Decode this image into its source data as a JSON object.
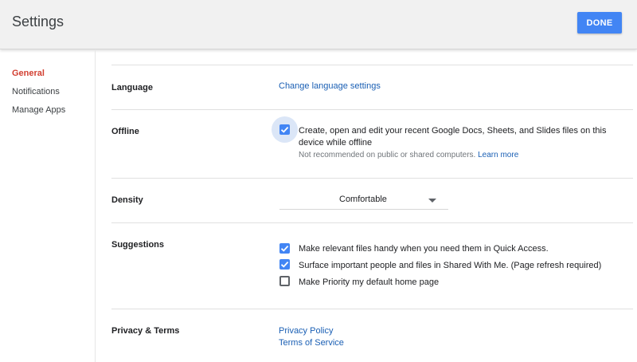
{
  "header": {
    "title": "Settings",
    "done_label": "DONE"
  },
  "sidebar": {
    "items": [
      {
        "label": "General",
        "active": true
      },
      {
        "label": "Notifications",
        "active": false
      },
      {
        "label": "Manage Apps",
        "active": false
      }
    ]
  },
  "sections": {
    "language": {
      "label": "Language",
      "link": "Change language settings"
    },
    "offline": {
      "label": "Offline",
      "checked": true,
      "text_line1": "Create, open and edit your recent Google Docs, Sheets, and Slides files on this",
      "text_line2": "device while offline",
      "note": "Not recommended on public or shared computers.",
      "note_link": "Learn more"
    },
    "density": {
      "label": "Density",
      "value": "Comfortable"
    },
    "suggestions": {
      "label": "Suggestions",
      "options": [
        {
          "text": "Make relevant files handy when you need them in Quick Access.",
          "checked": true
        },
        {
          "text": "Surface important people and files in Shared With Me. (Page refresh required)",
          "checked": true
        },
        {
          "text": "Make Priority my default home page",
          "checked": false
        }
      ]
    },
    "privacy": {
      "label": "Privacy & Terms",
      "links": [
        "Privacy Policy",
        "Terms of Service"
      ]
    }
  },
  "colors": {
    "accent": "#4285f4",
    "active_nav": "#d23f31",
    "link": "#1a5fb4"
  },
  "icons": {
    "checkbox_checked": "check-icon",
    "dropdown": "chevron-down-icon"
  }
}
